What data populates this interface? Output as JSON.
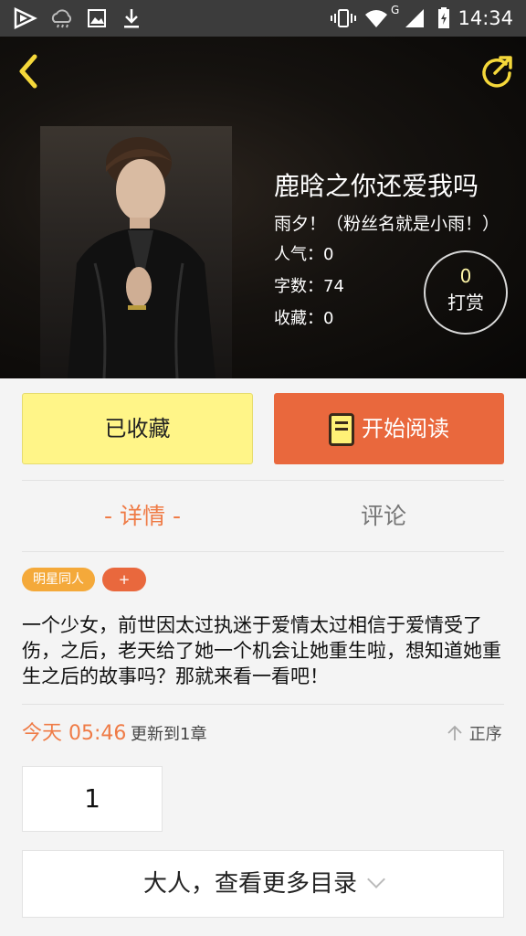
{
  "status_bar": {
    "time": "14:34",
    "network_label": "G"
  },
  "book": {
    "title": "鹿晗之你还爱我吗",
    "author": "雨夕！（粉丝名就是小雨！）",
    "popularity": "人气：0",
    "word_count": "字数：74",
    "favorites": "收藏：0"
  },
  "reward": {
    "count": "0",
    "label": "打赏"
  },
  "actions": {
    "collect_label": "已收藏",
    "read_label": "开始阅读"
  },
  "tabs": {
    "detail": "- 详情 -",
    "comment": "评论"
  },
  "tags": [
    "明星同人",
    "+"
  ],
  "summary": "一个少女，前世因太过执迷于爱情太过相信于爱情受了伤，之后，老天给了她一个机会让她重生啦，想知道她重生之后的故事吗？那就来看一看吧！",
  "update": {
    "time": "今天 05:46",
    "text": "更新到1章",
    "sort_label": "正序"
  },
  "chapters": [
    "1"
  ],
  "more_label": "大人，查看更多目录",
  "colors": {
    "accent": "#e9683d",
    "collect": "#fff588",
    "tag": "#f4a93a",
    "icon_yellow": "#f5d83a"
  }
}
